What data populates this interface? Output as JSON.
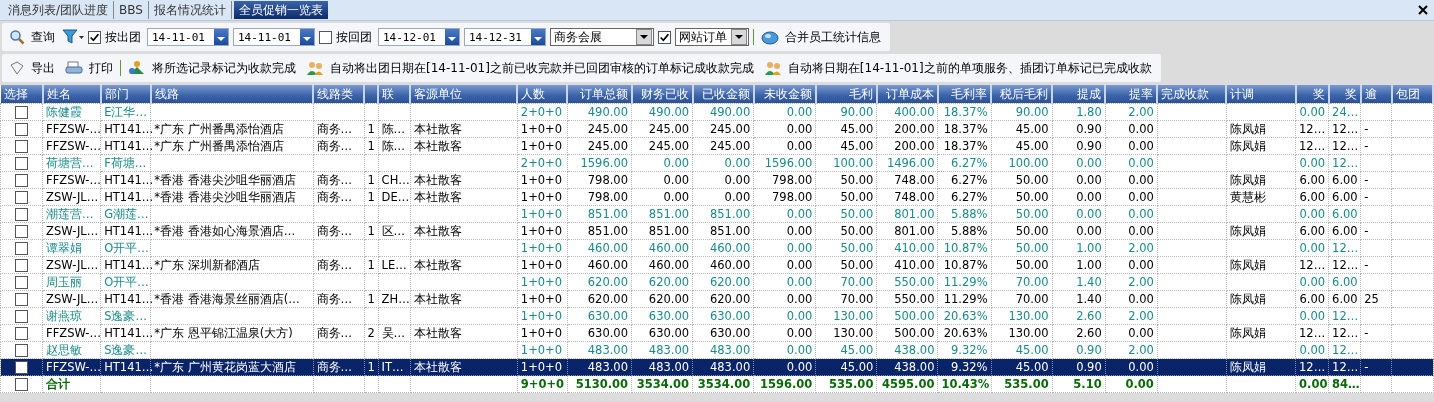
{
  "tabs": [
    {
      "label": "消息列表/团队进度",
      "selected": false
    },
    {
      "label": "BBS",
      "selected": false
    },
    {
      "label": "报名情况统计",
      "selected": false
    },
    {
      "label": "全员促销一览表",
      "selected": true
    }
  ],
  "toolbar": {
    "query": "查询",
    "by_departure": {
      "label": "按出团",
      "checked": true
    },
    "depart_from": "14-11-01",
    "depart_to": "14-11-01",
    "by_return": {
      "label": "按回团",
      "checked": false
    },
    "return_from": "14-12-01",
    "return_to": "14-12-31",
    "category": "商务会展",
    "category_filter": {
      "checked": true
    },
    "order_source": "网站订单",
    "merge": "合并员工统计信息"
  },
  "actions": {
    "export": "导出",
    "print": "打印",
    "mark_done": "将所选记录标记为收款完成",
    "auto_mark_orders": "自动将出团日期在[14-11-01]之前已收完款并已回团审核的订单标记成收款完成",
    "auto_mark_services": "自动将日期在[14-11-01]之前的单项服务、插团订单标记已完成收款"
  },
  "table": {
    "columns": [
      "选择",
      "姓名",
      "部门",
      "线路",
      "线路类",
      null,
      "联",
      "客源单位",
      "人数",
      "订单总额",
      "财务已收",
      "已收金额",
      "未收金额",
      "毛利",
      "订单成本",
      "毛利率",
      "税后毛利",
      "提成",
      "提率",
      "完成收款",
      "计调",
      "奖",
      "奖",
      "逾",
      "包团"
    ],
    "rows": [
      {
        "kind": "group",
        "selected": false,
        "checked": false,
        "cells": [
          "",
          "陈健霞",
          "E江华…",
          null,
          null,
          null,
          null,
          null,
          "2+0+0",
          "490.00",
          "490.00",
          "490.00",
          "0.00",
          "90.00",
          "400.00",
          "18.37%",
          "90.00",
          "1.80",
          "2.00",
          null,
          null,
          "0.00",
          "24…",
          null,
          null
        ]
      },
      {
        "kind": "order",
        "selected": false,
        "checked": false,
        "cells": [
          "",
          "FFZSW-…",
          "HT141…",
          "*广东 广州番禺添怡酒店",
          "商务…",
          "1",
          "陈…",
          "本社散客",
          "1+0+0",
          "245.00",
          "245.00",
          "245.00",
          "0.00",
          "45.00",
          "200.00",
          "18.37%",
          "45.00",
          "0.90",
          "0.00",
          null,
          "陈凤娟",
          "12…",
          "12…",
          "-",
          null
        ]
      },
      {
        "kind": "order",
        "selected": false,
        "checked": false,
        "cells": [
          "",
          "FFZSW-…",
          "HT141…",
          "*广东 广州番禺添怡酒店",
          "商务…",
          "1",
          "陈…",
          "本社散客",
          "1+0+0",
          "245.00",
          "245.00",
          "245.00",
          "0.00",
          "45.00",
          "200.00",
          "18.37%",
          "45.00",
          "0.90",
          "0.00",
          null,
          "陈凤娟",
          "12…",
          "12…",
          "-",
          null
        ]
      },
      {
        "kind": "group",
        "selected": false,
        "checked": false,
        "cells": [
          "",
          "荷塘营…",
          "F荷塘…",
          null,
          null,
          null,
          null,
          null,
          "2+0+0",
          "1596.00",
          "0.00",
          "0.00",
          "1596.00",
          "100.00",
          "1496.00",
          "6.27%",
          "100.00",
          "0.00",
          "0.00",
          null,
          null,
          "0.00",
          "12…",
          null,
          null
        ]
      },
      {
        "kind": "order",
        "selected": false,
        "checked": false,
        "cells": [
          "",
          "FFZSW-…",
          "HT141…",
          "*香港 香港尖沙咀华丽酒店",
          "商务…",
          "1",
          "CH…",
          "本社散客",
          "1+0+0",
          "798.00",
          "0.00",
          "0.00",
          "798.00",
          "50.00",
          "748.00",
          "6.27%",
          "50.00",
          "0.00",
          "0.00",
          null,
          "陈凤娟",
          "6.00",
          "6.00",
          "-",
          null
        ]
      },
      {
        "kind": "order",
        "selected": false,
        "checked": false,
        "cells": [
          "",
          "ZSW-JL…",
          "HT141…",
          "*香港 香港尖沙咀华丽酒店",
          "商务…",
          "1",
          "DE…",
          "本社散客",
          "1+0+0",
          "798.00",
          "0.00",
          "0.00",
          "798.00",
          "50.00",
          "748.00",
          "6.27%",
          "50.00",
          "0.00",
          "0.00",
          null,
          "黄慧彬",
          "6.00",
          "6.00",
          "-",
          null
        ]
      },
      {
        "kind": "group",
        "selected": false,
        "checked": false,
        "cells": [
          "",
          "潮莲营…",
          "G潮莲…",
          null,
          null,
          null,
          null,
          null,
          "1+0+0",
          "851.00",
          "851.00",
          "851.00",
          "0.00",
          "50.00",
          "801.00",
          "5.88%",
          "50.00",
          "0.00",
          "0.00",
          null,
          null,
          "0.00",
          "6.00",
          null,
          null
        ]
      },
      {
        "kind": "order",
        "selected": false,
        "checked": false,
        "cells": [
          "",
          "ZSW-JL…",
          "HT141…",
          "*香港  香港如心海景酒店…",
          "商务…",
          "1",
          "区…",
          "本社散客",
          "1+0+0",
          "851.00",
          "851.00",
          "851.00",
          "0.00",
          "50.00",
          "801.00",
          "5.88%",
          "50.00",
          "0.00",
          "0.00",
          null,
          "陈凤娟",
          "6.00",
          "6.00",
          "-",
          null
        ]
      },
      {
        "kind": "group",
        "selected": false,
        "checked": false,
        "cells": [
          "",
          "谭翠娟",
          "O开平…",
          null,
          null,
          null,
          null,
          null,
          "1+0+0",
          "460.00",
          "460.00",
          "460.00",
          "0.00",
          "50.00",
          "410.00",
          "10.87%",
          "50.00",
          "1.00",
          "2.00",
          null,
          null,
          "0.00",
          "12…",
          null,
          null
        ]
      },
      {
        "kind": "order",
        "selected": false,
        "checked": false,
        "cells": [
          "",
          "ZSW-JL…",
          "HT141…",
          "*广东 深圳新都酒店",
          "商务…",
          "1",
          "LE…",
          "本社散客",
          "1+0+0",
          "460.00",
          "460.00",
          "460.00",
          "0.00",
          "50.00",
          "410.00",
          "10.87%",
          "50.00",
          "1.00",
          "0.00",
          null,
          "陈凤娟",
          "12…",
          "12…",
          "-",
          null
        ]
      },
      {
        "kind": "group",
        "selected": false,
        "checked": false,
        "cells": [
          "",
          "周玉丽",
          "O开平…",
          null,
          null,
          null,
          null,
          null,
          "1+0+0",
          "620.00",
          "620.00",
          "620.00",
          "0.00",
          "70.00",
          "550.00",
          "11.29%",
          "70.00",
          "1.40",
          "2.00",
          null,
          null,
          "0.00",
          "6.00",
          null,
          null
        ]
      },
      {
        "kind": "order",
        "selected": false,
        "checked": false,
        "cells": [
          "",
          "ZSW-JL…",
          "HT141…",
          "*香港  香港海景丝丽酒店(…",
          "商务…",
          "1",
          "ZH…",
          "本社散客",
          "1+0+0",
          "620.00",
          "620.00",
          "620.00",
          "0.00",
          "70.00",
          "550.00",
          "11.29%",
          "70.00",
          "1.40",
          "0.00",
          null,
          "陈凤娟",
          "6.00",
          "6.00",
          "25",
          null
        ]
      },
      {
        "kind": "group",
        "selected": false,
        "checked": false,
        "cells": [
          "",
          "谢燕琼",
          "S逸豪…",
          null,
          null,
          null,
          null,
          null,
          "1+0+0",
          "630.00",
          "630.00",
          "630.00",
          "0.00",
          "130.00",
          "500.00",
          "20.63%",
          "130.00",
          "2.60",
          "2.00",
          null,
          null,
          "0.00",
          "12…",
          null,
          null
        ]
      },
      {
        "kind": "order",
        "selected": false,
        "checked": false,
        "cells": [
          "",
          "FFZSW-…",
          "HT141…",
          "*广东 恩平锦江温泉(大方)",
          "商务…",
          "2",
          "吴…",
          "本社散客",
          "1+0+0",
          "630.00",
          "630.00",
          "630.00",
          "0.00",
          "130.00",
          "500.00",
          "20.63%",
          "130.00",
          "2.60",
          "0.00",
          null,
          "陈凤娟",
          "12…",
          "12…",
          "-",
          null
        ]
      },
      {
        "kind": "group",
        "selected": false,
        "checked": false,
        "cells": [
          "",
          "赵思敏",
          "S逸豪…",
          null,
          null,
          null,
          null,
          null,
          "1+0+0",
          "483.00",
          "483.00",
          "483.00",
          "0.00",
          "45.00",
          "438.00",
          "9.32%",
          "45.00",
          "0.90",
          "2.00",
          null,
          null,
          "0.00",
          "12…",
          null,
          null
        ]
      },
      {
        "kind": "order",
        "selected": true,
        "checked": false,
        "cells": [
          "",
          "FFZSW-…",
          "HT141…",
          "*广东 广州黄花岗蓝大酒店",
          "商务…",
          "1",
          "IT…",
          "本社散客",
          "1+0+0",
          "483.00",
          "483.00",
          "483.00",
          "0.00",
          "45.00",
          "438.00",
          "9.32%",
          "45.00",
          "0.90",
          "0.00",
          null,
          "陈凤娟",
          "12…",
          "12…",
          "-",
          null
        ]
      },
      {
        "kind": "total",
        "selected": false,
        "checked": false,
        "cells": [
          "",
          "合计",
          null,
          null,
          null,
          null,
          null,
          null,
          "9+0+0",
          "5130.00",
          "3534.00",
          "3534.00",
          "1596.00",
          "535.00",
          "4595.00",
          "10.43%",
          "535.00",
          "5.10",
          "0.00",
          null,
          null,
          "0.00",
          "84…",
          null,
          null
        ]
      }
    ]
  }
}
